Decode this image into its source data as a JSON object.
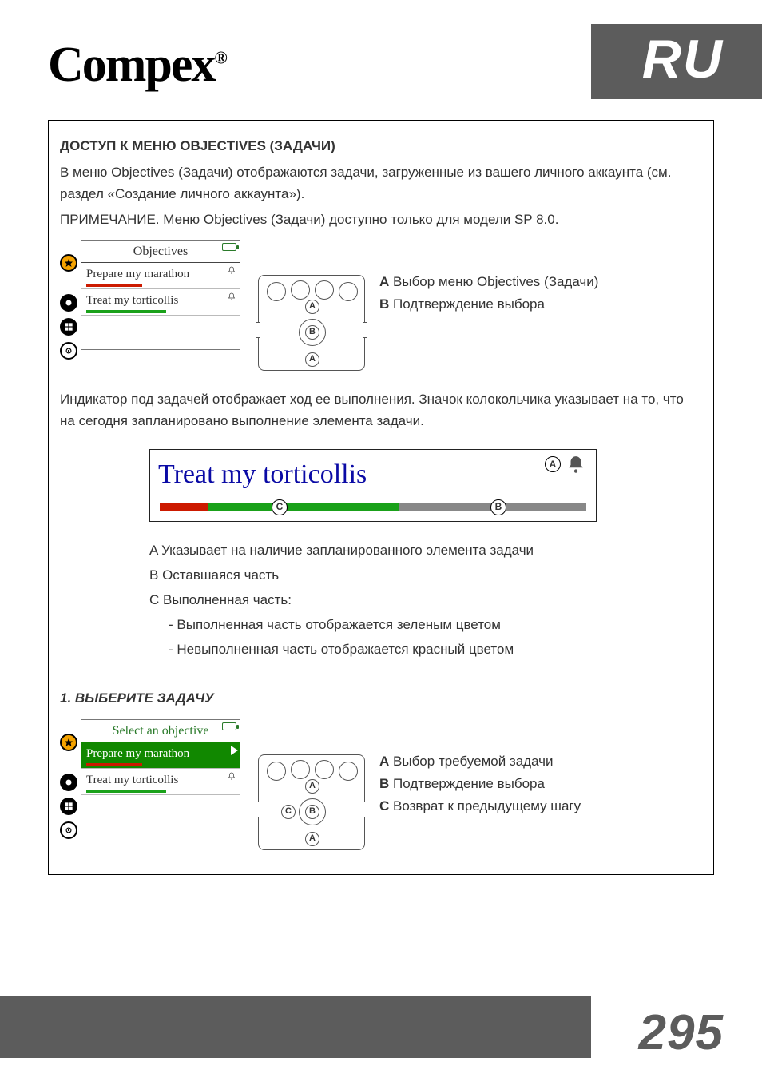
{
  "brand": "Compex",
  "brand_reg": "®",
  "language_badge": "RU",
  "page_number": "295",
  "section_heading": "ДОСТУП К МЕНЮ OBJECTIVES (ЗАДАЧИ)",
  "intro_p1": "В меню Objectives (Задачи) отображаются задачи, загруженные из вашего личного аккаунта (см. раздел «Создание личного аккаунта»).",
  "intro_p2": "ПРИМЕЧАНИЕ. Меню Objectives (Задачи) доступно только для модели SP 8.0.",
  "screen1": {
    "title": "Objectives",
    "items": [
      {
        "label": "Prepare my marathon",
        "progress_color": "red"
      },
      {
        "label": "Treat my torticollis",
        "progress_color": "green"
      }
    ]
  },
  "legend1": {
    "A": "Выбор меню Objectives (Задачи)",
    "B": "Подтверждение выбора"
  },
  "mid_para": "Индикатор под задачей отображает ход ее выполнения. Значок колокольчика указывает на то, что на сегодня запланировано выполнение элемента задачи.",
  "wide_title": "Treat my torticollis",
  "wide_legend": {
    "A": "Указывает на наличие запланированного элемента задачи",
    "B": "Оставшаяся часть",
    "C_head": "Выполненная часть:",
    "C_line1": "- Выполненная часть отображается зеленым цветом",
    "C_line2": "- Невыполненная часть отображается красный цветом"
  },
  "step1_heading": "1.   ВЫБЕРИТЕ ЗАДАЧУ",
  "screen2": {
    "title": "Select an objective",
    "items": [
      {
        "label": "Prepare my marathon",
        "selected": true,
        "progress_color": "red"
      },
      {
        "label": "Treat my torticollis",
        "selected": false,
        "progress_color": "green"
      }
    ]
  },
  "legend2": {
    "A": "Выбор требуемой задачи",
    "B": "Подтверждение выбора",
    "C": "Возврат к предыдущему шагу"
  },
  "labels": {
    "A": "A",
    "B": "B",
    "C": "C"
  }
}
